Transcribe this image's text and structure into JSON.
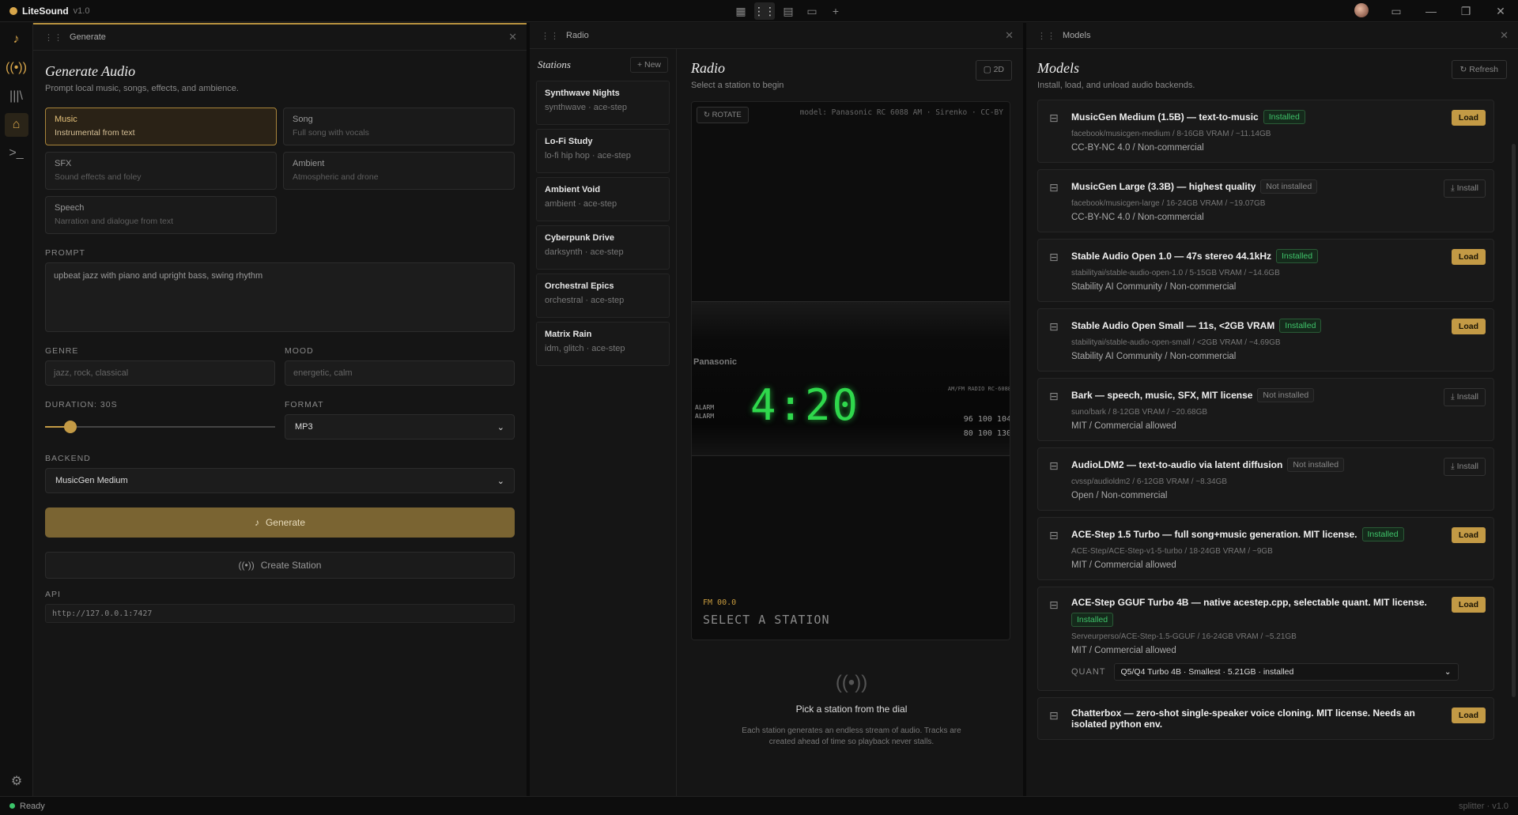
{
  "app": {
    "name": "LiteSound",
    "version": "v1.0"
  },
  "status": {
    "text": "Ready",
    "right": "splitter · v1.0"
  },
  "generate": {
    "panel_title": "Generate",
    "title": "Generate Audio",
    "subtitle": "Prompt local music, songs, effects, and ambience.",
    "types": [
      {
        "title": "Music",
        "desc": "Instrumental from text"
      },
      {
        "title": "Song",
        "desc": "Full song with vocals"
      },
      {
        "title": "SFX",
        "desc": "Sound effects and foley"
      },
      {
        "title": "Ambient",
        "desc": "Atmospheric and drone"
      },
      {
        "title": "Speech",
        "desc": "Narration and dialogue from text"
      }
    ],
    "prompt_label": "PROMPT",
    "prompt_value": "upbeat jazz with piano and upright bass, swing rhythm",
    "genre_label": "GENRE",
    "genre_placeholder": "jazz, rock, classical",
    "mood_label": "MOOD",
    "mood_placeholder": "energetic, calm",
    "duration_label": "DURATION: 30S",
    "duration_fraction": 0.11,
    "format_label": "FORMAT",
    "format_value": "MP3",
    "backend_label": "BACKEND",
    "backend_value": "MusicGen Medium",
    "generate_label": "Generate",
    "station_label": "Create Station",
    "api_label": "API",
    "api_value": "http://127.0.0.1:7427"
  },
  "radio": {
    "panel_title": "Radio",
    "stations_title": "Stations",
    "new_label": "+ New",
    "stations": [
      {
        "name": "Synthwave Nights",
        "genre": "synthwave · ace-step"
      },
      {
        "name": "Lo-Fi Study",
        "genre": "lo-fi hip hop · ace-step"
      },
      {
        "name": "Ambient Void",
        "genre": "ambient · ace-step"
      },
      {
        "name": "Cyberpunk Drive",
        "genre": "darksynth · ace-step"
      },
      {
        "name": "Orchestral Epics",
        "genre": "orchestral · ace-step"
      },
      {
        "name": "Matrix Rain",
        "genre": "idm, glitch · ace-step"
      }
    ],
    "title": "Radio",
    "subtitle": "Select a station to begin",
    "view_label": "2D",
    "rotate_label": "ROTATE",
    "model_tag": "model: Panasonic RC 6088 AM · Sirenko · CC-BY",
    "clock_brand": "Panasonic",
    "alarm_1": "ALARM",
    "alarm_2": "ALARM",
    "clock_time": "4:20",
    "radio_tag": "AM/FM RADIO RC-6088",
    "freq_1": "96 100 104",
    "freq_2": "80 100 130",
    "fm": "FM 00.0",
    "select_station": "SELECT A STATION",
    "pick_title": "Pick a station from the dial",
    "pick_desc": "Each station generates an endless stream of audio. Tracks are created ahead of time so playback never stalls."
  },
  "models": {
    "panel_title": "Models",
    "title": "Models",
    "subtitle": "Install, load, and unload audio backends.",
    "refresh_label": "Refresh",
    "items": [
      {
        "name": "MusicGen Medium (1.5B) — text-to-music",
        "badge": "Installed",
        "path": "facebook/musicgen-medium / 8-16GB VRAM / ~11.14GB",
        "license": "CC-BY-NC 4.0 / Non-commercial",
        "action": "Load"
      },
      {
        "name": "MusicGen Large (3.3B) — highest quality",
        "badge": "Not installed",
        "path": "facebook/musicgen-large / 16-24GB VRAM / ~19.07GB",
        "license": "CC-BY-NC 4.0 / Non-commercial",
        "action": "Install"
      },
      {
        "name": "Stable Audio Open 1.0 — 47s stereo 44.1kHz",
        "badge": "Installed",
        "path": "stabilityai/stable-audio-open-1.0 / 5-15GB VRAM / ~14.6GB",
        "license": "Stability AI Community / Non-commercial",
        "action": "Load"
      },
      {
        "name": "Stable Audio Open Small — 11s, <2GB VRAM",
        "badge": "Installed",
        "path": "stabilityai/stable-audio-open-small / <2GB VRAM / ~4.69GB",
        "license": "Stability AI Community / Non-commercial",
        "action": "Load"
      },
      {
        "name": "Bark — speech, music, SFX, MIT license",
        "badge": "Not installed",
        "path": "suno/bark / 8-12GB VRAM / ~20.68GB",
        "license": "MIT / Commercial allowed",
        "action": "Install"
      },
      {
        "name": "AudioLDM2 — text-to-audio via latent diffusion",
        "badge": "Not installed",
        "path": "cvssp/audioldm2 / 6-12GB VRAM / ~8.34GB",
        "license": "Open / Non-commercial",
        "action": "Install"
      },
      {
        "name": "ACE-Step 1.5 Turbo — full song+music generation. MIT license.",
        "badge": "Installed",
        "path": "ACE-Step/ACE-Step-v1-5-turbo / 18-24GB VRAM / ~9GB",
        "license": "MIT / Commercial allowed",
        "action": "Load"
      }
    ],
    "gguf": {
      "name": "ACE-Step GGUF Turbo 4B — native acestep.cpp, selectable quant. MIT license.",
      "badge": "Installed",
      "path": "Serveurperso/ACE-Step-1.5-GGUF / 16-24GB VRAM / ~5.21GB",
      "license": "MIT / Commercial allowed",
      "action": "Load",
      "quant_label": "QUANT",
      "quant_value": "Q5/Q4 Turbo 4B · Smallest · 5.21GB · installed"
    },
    "chatterbox": {
      "name": "Chatterbox — zero-shot single-speaker voice cloning. MIT license. Needs an isolated python env.",
      "action": "Load"
    }
  }
}
